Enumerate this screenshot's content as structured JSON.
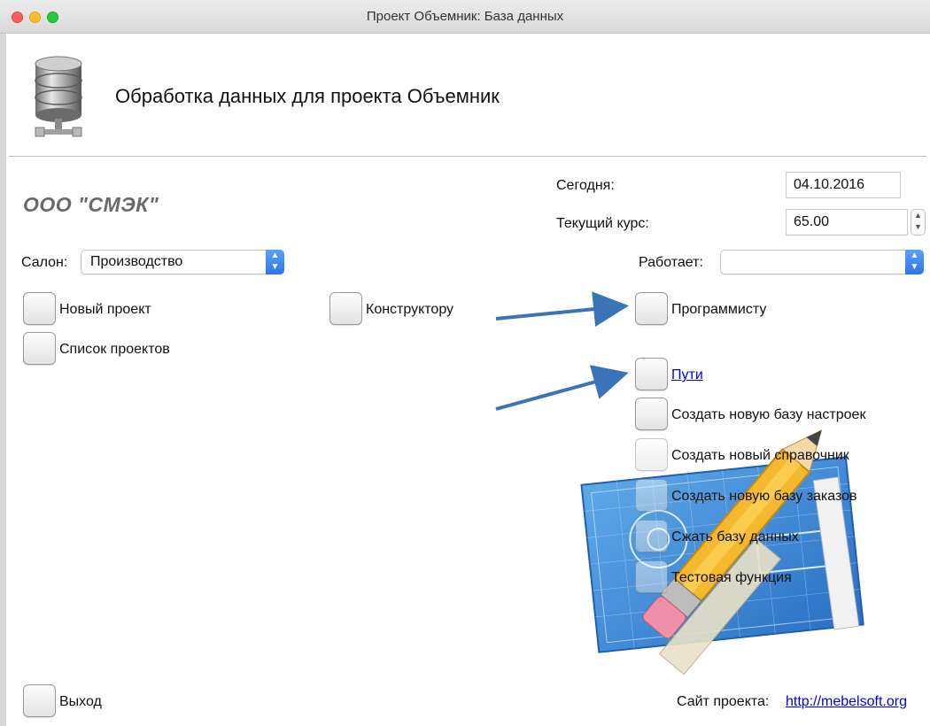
{
  "window": {
    "title": "Проект Объемник: База данных",
    "traffic_lights": [
      "#fe5f57",
      "#febc2e",
      "#28c840"
    ]
  },
  "header": {
    "title": "Обработка данных для проекта Объемник",
    "icon": "database-icon"
  },
  "company": "ООО \"СМЭК\"",
  "today": {
    "label": "Сегодня:",
    "value": "04.10.2016"
  },
  "rate": {
    "label": "Текущий курс:",
    "value": "65.00"
  },
  "salon": {
    "label": "Салон:",
    "value": "Производство"
  },
  "works": {
    "label": "Работает:",
    "value": ""
  },
  "buttons": {
    "new_project": "Новый проект",
    "project_list": "Список проектов",
    "designer": "Конструктору",
    "programmer": "Программисту",
    "paths": "Пути",
    "create_settings_db": "Создать новую базу настроек",
    "create_reference": "Создать новый справочник",
    "create_orders_db": "Создать новую базу заказов",
    "compress_db": "Сжать базу данных",
    "test_function": "Тестовая функция",
    "exit": "Выход"
  },
  "footer": {
    "site_label": "Сайт проекта:",
    "site_link": "http://mebelsoft.org"
  },
  "colors": {
    "arrow": "#3a73b8",
    "accent": "#2f74e6",
    "link": "#0000ee",
    "company": "#6a6a6a"
  }
}
